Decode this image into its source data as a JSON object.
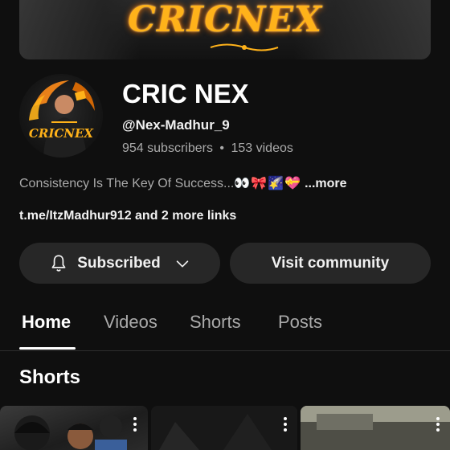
{
  "banner": {
    "title": "CRICNEX"
  },
  "channel": {
    "name": "CRIC NEX",
    "handle": "@Nex-Madhur_9",
    "subscribers": "954 subscribers",
    "separator": "•",
    "videos": "153 videos",
    "avatar_text": "CRICNEX"
  },
  "description": {
    "text": "Consistency Is The Key Of Success...",
    "emojis": "👀🎀🌠💝",
    "more": "...more"
  },
  "links": {
    "text": "t.me/ItzMadhur912 and 2 more links"
  },
  "buttons": {
    "subscribed": "Subscribed",
    "visit_community": "Visit community"
  },
  "tabs": [
    {
      "label": "Home",
      "active": true
    },
    {
      "label": "Videos",
      "active": false
    },
    {
      "label": "Shorts",
      "active": false
    },
    {
      "label": "Posts",
      "active": false
    }
  ],
  "section": {
    "title": "Shorts"
  },
  "colors": {
    "background": "#0f0f0f",
    "button": "#272727",
    "muted": "#aaaaaa",
    "banner_text": "#ffb21a"
  },
  "icons": [
    "bell-icon",
    "chevron-down-icon",
    "more-vert-icon"
  ]
}
